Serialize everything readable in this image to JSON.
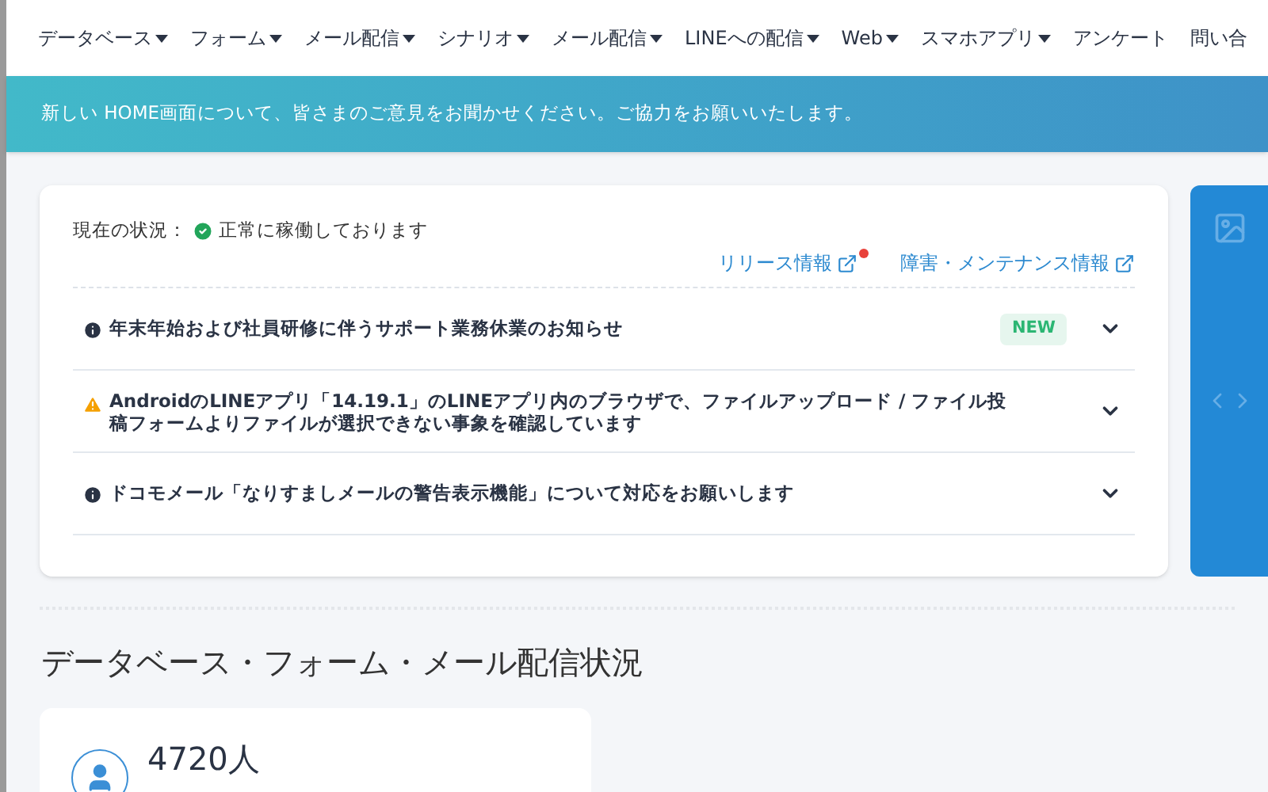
{
  "nav": [
    {
      "label": "データベース",
      "has_menu": true
    },
    {
      "label": "フォーム",
      "has_menu": true
    },
    {
      "label": "メール配信",
      "has_menu": true
    },
    {
      "label": "シナリオ",
      "has_menu": true
    },
    {
      "label": "メール配信",
      "has_menu": true
    },
    {
      "label": "LINEへの配信",
      "has_menu": true
    },
    {
      "label": "Web",
      "has_menu": true
    },
    {
      "label": "スマホアプリ",
      "has_menu": true
    },
    {
      "label": "アンケート",
      "has_menu": false
    },
    {
      "label": "問い合",
      "has_menu": false
    }
  ],
  "banner": "新しい HOME画面について、皆さまのご意見をお聞かせください。ご協力をお願いいたします。",
  "status": {
    "label": "現在の状況：",
    "ok": true,
    "text": "正常に稼働しております"
  },
  "links": [
    {
      "label": "リリース情報",
      "unread": true
    },
    {
      "label": "障害・メンテナンス情報",
      "unread": false
    }
  ],
  "notices": [
    {
      "kind": "info",
      "title": "年末年始および社員研修に伴うサポート業務休業のお知らせ",
      "badge": "NEW",
      "expanded": false
    },
    {
      "kind": "warning",
      "title": "AndroidのLINEアプリ「14.19.1」のLINEアプリ内のブラウザで、ファイルアップロード / ファイル投稿フォームよりファイルが選択できない事象を確認しています",
      "expanded": false
    },
    {
      "kind": "info",
      "title": "ドコモメール「なりすましメールの警告表示機能」について対応をお願いします",
      "expanded": false
    }
  ],
  "section_title": "データベース・フォーム・メール配信状況",
  "stat": {
    "value": "4720人"
  }
}
